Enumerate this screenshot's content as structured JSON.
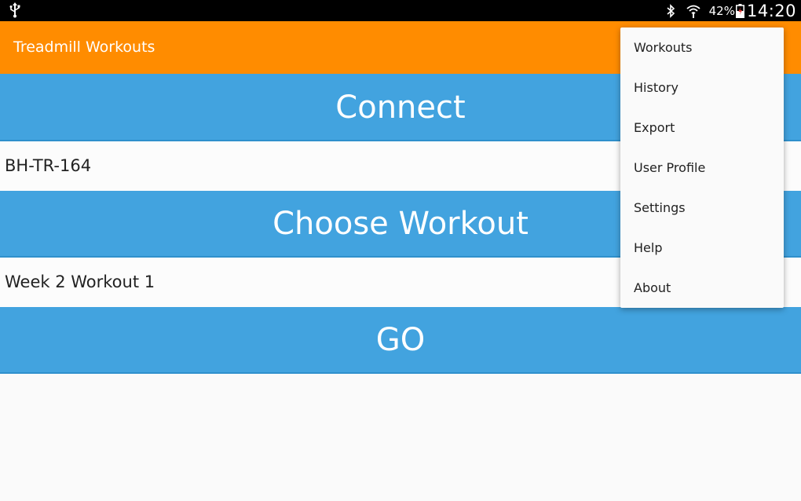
{
  "status_bar": {
    "usb_icon": "usb-icon",
    "bluetooth_icon": "bluetooth-icon",
    "wifi_icon": "wifi-icon",
    "battery_percent": "42%",
    "battery_icon": "battery-icon",
    "time": "14:20"
  },
  "action_bar": {
    "title": "Treadmill Workouts",
    "color": "#ff8c00"
  },
  "main": {
    "connect_label": "Connect",
    "device_value": "BH-TR-164",
    "choose_workout_label": "Choose Workout",
    "workout_value": "Week 2 Workout 1",
    "go_label": "GO",
    "button_color": "#42a3df"
  },
  "overflow_menu": {
    "items": [
      {
        "label": "Workouts"
      },
      {
        "label": "History"
      },
      {
        "label": "Export"
      },
      {
        "label": "User Profile"
      },
      {
        "label": "Settings"
      },
      {
        "label": "Help"
      },
      {
        "label": "About"
      }
    ]
  }
}
